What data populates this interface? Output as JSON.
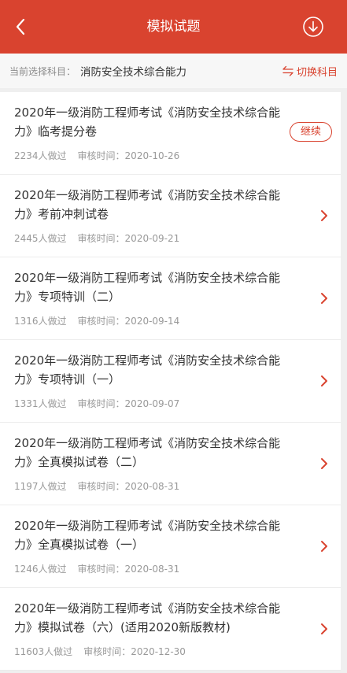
{
  "theme": {
    "accent": "#d9432f",
    "text_primary": "#333333",
    "text_secondary": "#999999"
  },
  "header": {
    "title": "模拟试题",
    "back_icon": "chevron-left-icon",
    "download_icon": "download-circle-icon"
  },
  "subject_bar": {
    "label": "当前选择科目：",
    "subject": "消防安全技术综合能力",
    "switch_icon": "swap-arrows-icon",
    "switch_label": "切换科目"
  },
  "exams": [
    {
      "title_lines": [
        "2020年一级消防工程师考试《消防安全技术综合能",
        "力》临考提分卷"
      ],
      "count": "2234人做过",
      "review": "审核时间：2020-10-26",
      "action": "继续"
    },
    {
      "title_lines": [
        "2020年一级消防工程师考试《消防安全技术综合能",
        "力》考前冲刺试卷"
      ],
      "count": "2445人做过",
      "review": "审核时间：2020-09-21",
      "action_icon": "chevron-right-icon"
    },
    {
      "title_lines": [
        "2020年一级消防工程师考试《消防安全技术综合能",
        "力》专项特训（二）"
      ],
      "count": "1316人做过",
      "review": "审核时间：2020-09-14",
      "action_icon": "chevron-right-icon"
    },
    {
      "title_lines": [
        "2020年一级消防工程师考试《消防安全技术综合能",
        "力》专项特训（一）"
      ],
      "count": "1331人做过",
      "review": "审核时间：2020-09-07",
      "action_icon": "chevron-right-icon"
    },
    {
      "title_lines": [
        "2020年一级消防工程师考试《消防安全技术综合能",
        "力》全真模拟试卷（二）"
      ],
      "count": "1197人做过",
      "review": "审核时间：2020-08-31",
      "action_icon": "chevron-right-icon"
    },
    {
      "title_lines": [
        "2020年一级消防工程师考试《消防安全技术综合能",
        "力》全真模拟试卷（一）"
      ],
      "count": "1246人做过",
      "review": "审核时间：2020-08-31",
      "action_icon": "chevron-right-icon"
    },
    {
      "title_lines": [
        "2020年一级消防工程师考试《消防安全技术综合能",
        "力》模拟试卷（六）(适用2020新版教材)"
      ],
      "count": "11603人做过",
      "review": "审核时间：2020-12-30",
      "action_icon": "chevron-right-icon"
    }
  ]
}
